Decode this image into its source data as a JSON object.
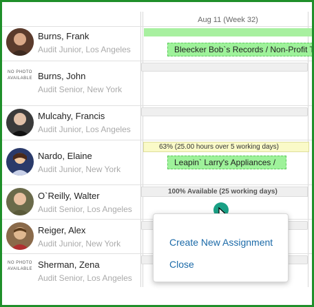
{
  "header": {
    "week_label": "Aug 11 (Week 32)"
  },
  "people": [
    {
      "name": "Burns, Frank",
      "subtitle": "Audit Junior, Los Angeles",
      "photo": "avatar"
    },
    {
      "name": "Burns, John",
      "subtitle": "Audit Senior, New York",
      "photo": "no-photo",
      "no_photo_text": "NO PHOTO AVAILABLE"
    },
    {
      "name": "Mulcahy, Francis",
      "subtitle": "Audit Junior, Los Angeles",
      "photo": "avatar"
    },
    {
      "name": "Nardo, Elaine",
      "subtitle": "Audit Junior, New York",
      "photo": "avatar"
    },
    {
      "name": "O`Reilly, Walter",
      "subtitle": "Audit Senior, Los Angeles",
      "photo": "avatar"
    },
    {
      "name": "Reiger, Alex",
      "subtitle": "Audit Junior, New York",
      "photo": "avatar"
    },
    {
      "name": "Sherman, Zena",
      "subtitle": "Audit Senior, Los Angeles",
      "photo": "no-photo",
      "no_photo_text": "NO PHOTO AVAILABLE"
    }
  ],
  "schedule": {
    "frank_assignment": "Bleecker Bob`s Records / Non-Profit Te",
    "elaine_utilization": "63% (25.00 hours over 5 working days)",
    "elaine_assignment": "Leapin` Larry's Appliances /",
    "walter_availability": "100% Available (25 working days)"
  },
  "context_menu": {
    "create_label": "Create New Assignment",
    "close_label": "Close"
  },
  "colors": {
    "frame_border": "#1f8f2a",
    "assignment_green": "#9ef29a",
    "utilization_yellow": "#fafac8",
    "menu_link": "#1b6aa8",
    "marker_teal": "#1aa085"
  }
}
